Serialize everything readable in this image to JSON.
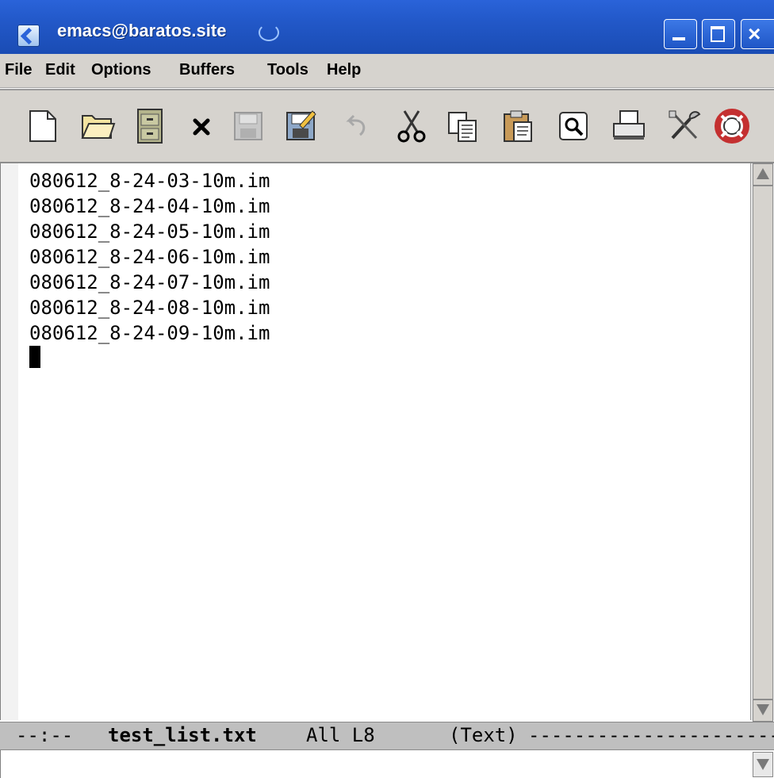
{
  "window": {
    "title": "emacs@baratos.site",
    "controls": [
      "minimize",
      "maximize",
      "close"
    ],
    "close_glyph": "×"
  },
  "menubar": {
    "items": [
      "File",
      "Edit",
      "Options",
      "Buffers",
      "Tools",
      "Help"
    ]
  },
  "toolbar": {
    "buttons": [
      {
        "icon": "new-file-icon"
      },
      {
        "icon": "open-folder-icon"
      },
      {
        "icon": "dired-cabinet-icon"
      },
      {
        "icon": "kill-buffer-icon"
      },
      {
        "icon": "save-icon",
        "disabled": true
      },
      {
        "icon": "write-file-icon"
      },
      {
        "icon": "undo-icon",
        "disabled": true
      },
      {
        "icon": "cut-icon"
      },
      {
        "icon": "copy-icon"
      },
      {
        "icon": "paste-icon"
      },
      {
        "icon": "search-icon"
      },
      {
        "icon": "print-icon"
      },
      {
        "icon": "customize-icon"
      },
      {
        "icon": "help-icon"
      }
    ]
  },
  "buffer": {
    "lines": [
      "080612_8-24-03-10m.im",
      "080612_8-24-04-10m.im",
      "080612_8-24-05-10m.im",
      "080612_8-24-06-10m.im",
      "080612_8-24-07-10m.im",
      "080612_8-24-08-10m.im",
      "080612_8-24-09-10m.im"
    ]
  },
  "modeline": {
    "status": "--:--",
    "buffer_name": "test_list.txt",
    "position": "All L8",
    "mode": "(Text)",
    "fill": "----------------------------"
  },
  "colors": {
    "titlebar": "#2258c8",
    "chrome": "#d6d3ce",
    "modeline": "#bfbfbf"
  }
}
